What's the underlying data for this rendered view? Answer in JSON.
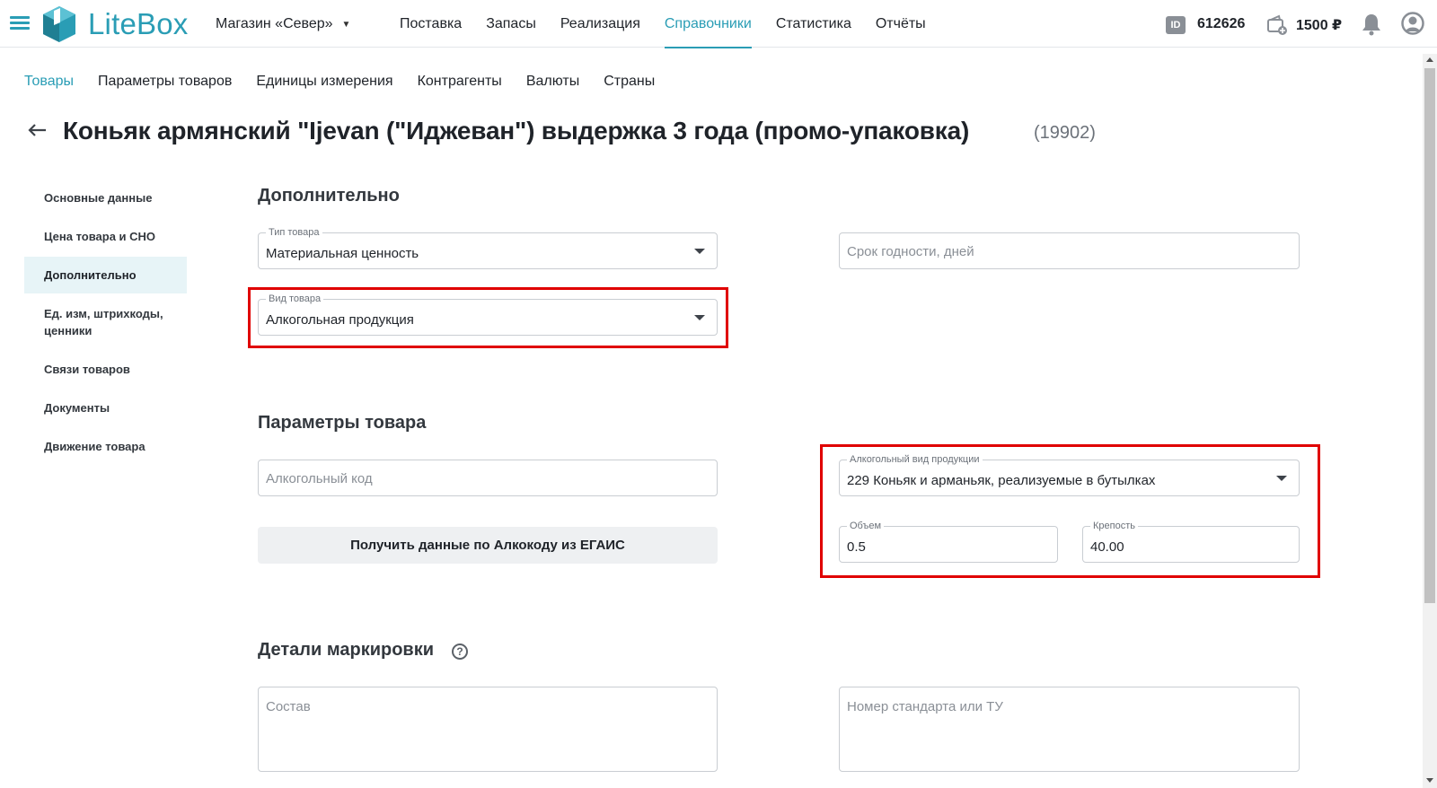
{
  "header": {
    "logo_text": "LiteBox",
    "store": "Магазин «Север»",
    "nav": [
      {
        "label": "Поставка"
      },
      {
        "label": "Запасы"
      },
      {
        "label": "Реализация"
      },
      {
        "label": "Справочники"
      },
      {
        "label": "Статистика"
      },
      {
        "label": "Отчёты"
      }
    ],
    "active_nav": "Справочники",
    "id_icon": "ID",
    "id_value": "612626",
    "balance": "1500 ₽"
  },
  "subnav": [
    {
      "label": "Товары"
    },
    {
      "label": "Параметры товаров"
    },
    {
      "label": "Единицы измерения"
    },
    {
      "label": "Контрагенты"
    },
    {
      "label": "Валюты"
    },
    {
      "label": "Страны"
    }
  ],
  "title": {
    "text": "Коньяк армянский \"Ijevan (\"Иджеван\") выдержка 3 года (промо-упаковка)",
    "id": "(19902)"
  },
  "sidemenu": [
    {
      "label": "Основные данные"
    },
    {
      "label": "Цена товара и СНО"
    },
    {
      "label": "Дополнительно"
    },
    {
      "label": "Ед. изм, штрихкоды, ценники"
    },
    {
      "label": "Связи товаров"
    },
    {
      "label": "Документы"
    },
    {
      "label": "Движение товара"
    }
  ],
  "sections": {
    "additional": {
      "title": "Дополнительно",
      "product_type": {
        "label": "Тип товара",
        "value": "Материальная ценность"
      },
      "shelf_life": {
        "placeholder": "Срок годности, дней"
      },
      "product_kind": {
        "label": "Вид товара",
        "value": "Алкогольная продукция"
      }
    },
    "params": {
      "title": "Параметры товара",
      "alco_code": {
        "placeholder": "Алкогольный код"
      },
      "egais_button": "Получить данные по Алкокоду из ЕГАИС",
      "alco_kind": {
        "label": "Алкогольный вид продукции",
        "value": "229 Коньяк и арманьяк, реализуемые в бутылках"
      },
      "volume": {
        "label": "Объем",
        "value": "0.5"
      },
      "strength": {
        "label": "Крепость",
        "value": "40.00"
      }
    },
    "marking": {
      "title": "Детали маркировки",
      "help": "?",
      "composition": {
        "placeholder": "Состав"
      },
      "standard": {
        "placeholder": "Номер стандарта или ТУ"
      }
    }
  },
  "colors": {
    "accent": "#2a9db5",
    "highlight": "#e00000"
  }
}
